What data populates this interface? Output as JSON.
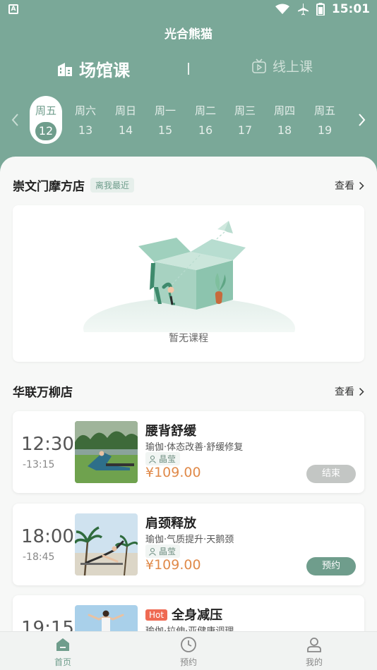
{
  "status_bar": {
    "left_icon": "A",
    "time": "15:01",
    "icons": [
      "wifi-icon",
      "airplane-icon",
      "battery-icon"
    ]
  },
  "app_title": "光合熊猫",
  "mode_tabs": [
    {
      "label": "场馆课",
      "icon": "building-icon",
      "active": true
    },
    {
      "label": "线上课",
      "icon": "tv-play-icon",
      "active": false
    }
  ],
  "dates": [
    {
      "weekday": "周五",
      "day": "12",
      "selected": true
    },
    {
      "weekday": "周六",
      "day": "13"
    },
    {
      "weekday": "周日",
      "day": "14"
    },
    {
      "weekday": "周一",
      "day": "15"
    },
    {
      "weekday": "周二",
      "day": "16"
    },
    {
      "weekday": "周三",
      "day": "17"
    },
    {
      "weekday": "周四",
      "day": "18"
    },
    {
      "weekday": "周五",
      "day": "19"
    }
  ],
  "stores": [
    {
      "name": "崇文门摩方店",
      "badge": "离我最近",
      "view_label": "查看",
      "empty_text": "暂无课程"
    },
    {
      "name": "华联万柳店",
      "view_label": "查看"
    }
  ],
  "classes": [
    {
      "start": "12:30",
      "end": "-13:15",
      "title": "腰背舒缓",
      "tags": "瑜伽·体态改善·舒缓修复",
      "coach": "晶莹",
      "price": "¥109.00",
      "button": "结束",
      "hot": ""
    },
    {
      "start": "18:00",
      "end": "-18:45",
      "title": "肩颈释放",
      "tags": "瑜伽·气质提升·天鹅颈",
      "coach": "晶莹",
      "price": "¥109.00",
      "button": "预约",
      "hot": ""
    },
    {
      "start": "19:15",
      "end": "",
      "title": "全身减压",
      "tags": "瑜伽·拉伸·亚健康调理",
      "coach": "",
      "price": "",
      "button": "",
      "hot": "Hot"
    }
  ],
  "tabbar": [
    {
      "label": "首页",
      "icon": "home-icon",
      "active": true
    },
    {
      "label": "预约",
      "icon": "clock-icon",
      "active": false
    },
    {
      "label": "我的",
      "icon": "user-icon",
      "active": false
    }
  ],
  "colors": {
    "primary": "#7aa898",
    "accent": "#6f9d8c",
    "price": "#e08a4a",
    "hot": "#ef6a53"
  }
}
